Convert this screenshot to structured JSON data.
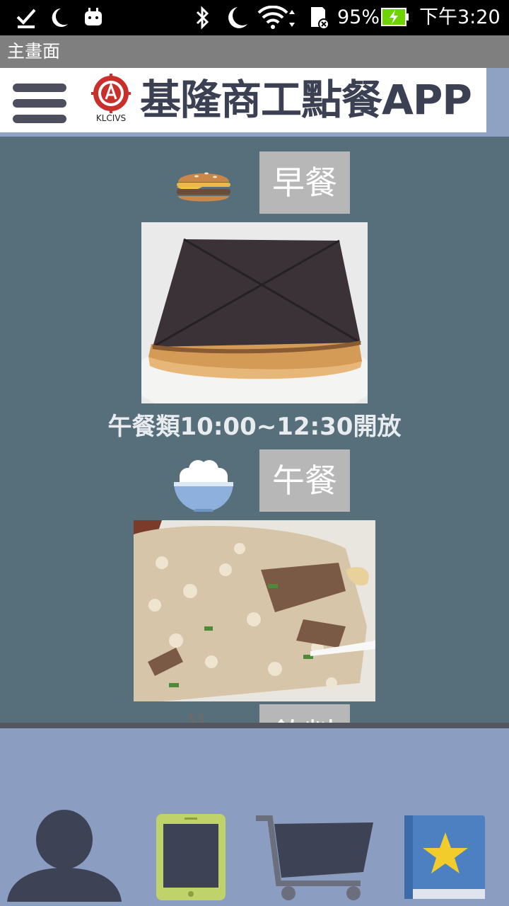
{
  "status_bar": {
    "battery": "95%",
    "time": "下午3:20"
  },
  "title_bar": {
    "title": "主畫面"
  },
  "header": {
    "app_title": "基隆商工點餐APP",
    "logo_text": "KLCIVS"
  },
  "categories": {
    "breakfast_label": "早餐",
    "lunch_label": "午餐",
    "drink_label": "飲料",
    "lunch_notice": "午餐類10:00~12:30開放"
  },
  "bottom_nav": [
    {
      "icon": "user-icon"
    },
    {
      "icon": "tablet-icon"
    },
    {
      "icon": "shopping-cart-icon"
    },
    {
      "icon": "favorites-book-icon"
    }
  ],
  "colors": {
    "content_bg": "#576e7b",
    "bottom_bg": "#8b9ec1",
    "button_bg": "#b7b7b7"
  }
}
